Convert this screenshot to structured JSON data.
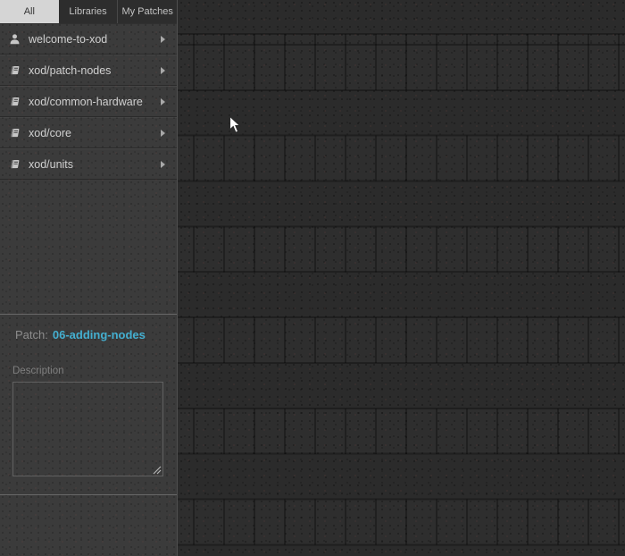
{
  "sidebar": {
    "tabs": [
      {
        "label": "All",
        "active": true
      },
      {
        "label": "Libraries",
        "active": false
      },
      {
        "label": "My Patches",
        "active": false
      }
    ],
    "project_browser": {
      "items": [
        {
          "label": "welcome-to-xod",
          "icon": "user-icon"
        },
        {
          "label": "xod/patch-nodes",
          "icon": "book-icon"
        },
        {
          "label": "xod/common-hardware",
          "icon": "book-icon"
        },
        {
          "label": "xod/core",
          "icon": "book-icon"
        },
        {
          "label": "xod/units",
          "icon": "book-icon"
        }
      ]
    },
    "patch_panel": {
      "patch_label": "Patch:",
      "patch_name": "06-adding-nodes",
      "description_label": "Description",
      "description_value": ""
    }
  },
  "colors": {
    "accent_link": "#44afd0",
    "canvas_bg": "#2c2c2c",
    "grid_line": "#232323",
    "sidebar_bg": "#3b3b3b",
    "active_tab_bg": "#d5d5d5"
  }
}
